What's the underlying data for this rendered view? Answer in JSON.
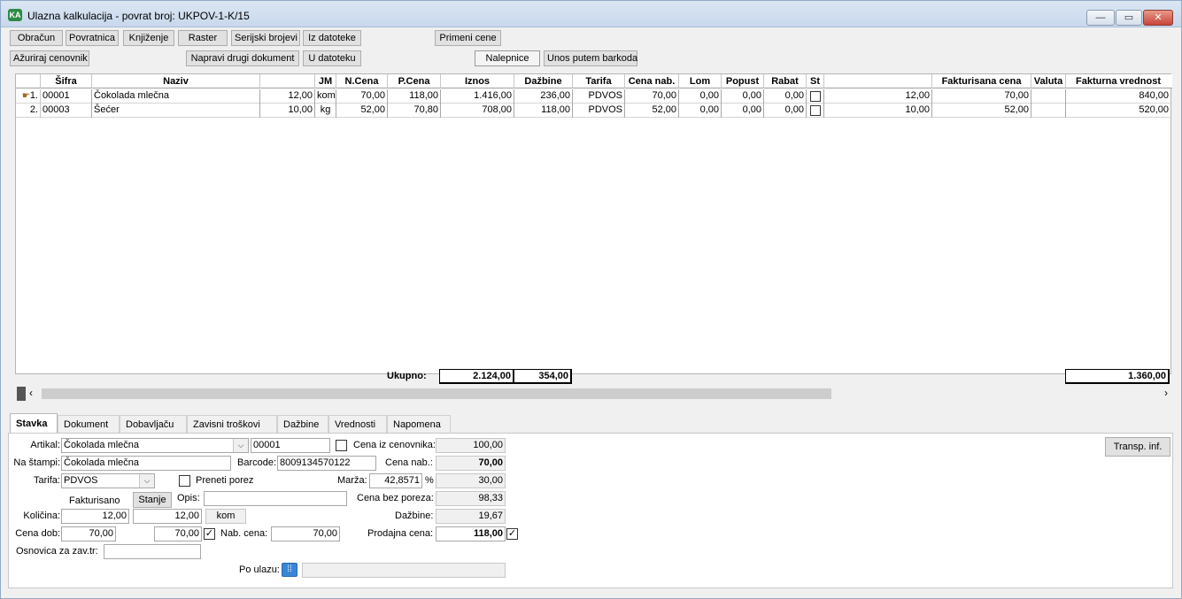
{
  "window": {
    "title": "Ulazna kalkulacija - povrat broj: UKPOV-1-K/15",
    "app_icon": "app-logo-icon"
  },
  "toolbar": {
    "obracun": "Obračun",
    "povratnica": "Povratnica",
    "knjizenje": "Knjiženje",
    "raster": "Raster",
    "serijski": "Serijski brojevi",
    "iz_datoteke": "Iz datoteke",
    "primeni_cene": "Primeni cene",
    "azuriraj": "Ažuriraj cenovnik",
    "napravi": "Napravi drugi dokument",
    "u_datoteku": "U datoteku",
    "nalepnice": "Nalepnice",
    "barkod": "Unos putem barkoda"
  },
  "grid": {
    "columns": [
      "",
      "Šifra",
      "Naziv",
      "",
      "JM",
      "N.Cena",
      "P.Cena",
      "Iznos",
      "Dažbine",
      "Tarifa",
      "Cena nab.",
      "Lom",
      "Popust",
      "Rabat",
      "St",
      "",
      "Fakturisana cena",
      "Valuta",
      "Fakturna vrednost"
    ],
    "rows": [
      {
        "num": "1.",
        "sifra": "00001",
        "naziv": "Čokolada mlečna",
        "kol": "12,00",
        "jm": "kom",
        "ncena": "70,00",
        "pcena": "118,00",
        "iznos": "1.416,00",
        "dazbine": "236,00",
        "tarifa": "PDVOS",
        "cenanab": "70,00",
        "lom": "0,00",
        "popust": "0,00",
        "rabat": "0,00",
        "kol2": "12,00",
        "fcena": "70,00",
        "valuta": "",
        "fvred": "840,00"
      },
      {
        "num": "2.",
        "sifra": "00003",
        "naziv": "Šećer",
        "kol": "10,00",
        "jm": "kg",
        "ncena": "52,00",
        "pcena": "70,80",
        "iznos": "708,00",
        "dazbine": "118,00",
        "tarifa": "PDVOS",
        "cenanab": "52,00",
        "lom": "0,00",
        "popust": "0,00",
        "rabat": "0,00",
        "kol2": "10,00",
        "fcena": "52,00",
        "valuta": "",
        "fvred": "520,00"
      }
    ],
    "totals": {
      "label": "Ukupno:",
      "iznos": "2.124,00",
      "dazbine": "354,00",
      "fvred": "1.360,00"
    }
  },
  "tabs": [
    "Stavka",
    "Dokument",
    "Dobavljaču",
    "Zavisni troškovi",
    "Dažbine",
    "Vrednosti",
    "Napomena"
  ],
  "form": {
    "artikal_label": "Artikal:",
    "artikal_value": "Čokolada mlečna",
    "artikal_code": "00001",
    "cena_iz_cenovnika_label": "Cena iz cenovnika:",
    "cena_iz_cenovnika": "100,00",
    "na_stampi_label": "Na štampi:",
    "na_stampi_value": "Čokolada mlečna",
    "barcode_label": "Barcode:",
    "barcode_value": "8009134570122",
    "cena_nab_label": "Cena nab.:",
    "cena_nab": "70,00",
    "tarifa_label": "Tarifa:",
    "tarifa_value": "PDVOS",
    "preneti_porez_label": "Preneti porez",
    "marza_label": "Marža:",
    "marza_value": "42,8571",
    "marza_unit": "%",
    "marza_amount": "30,00",
    "fakturisano_label": "Fakturisano",
    "stanje_button": "Stanje",
    "opis_label": "Opis:",
    "opis_value": "",
    "cena_bez_poreza_label": "Cena bez poreza:",
    "cena_bez_poreza": "98,33",
    "kolicina_label": "Količina:",
    "kolicina_fakt": "12,00",
    "kolicina_stanje": "12,00",
    "jm": "kom",
    "dazbine_label": "Dažbine:",
    "dazbine": "19,67",
    "cena_dob_label": "Cena dob:",
    "cena_dob_fakt": "70,00",
    "cena_dob": "70,00",
    "nab_cena_label": "Nab. cena:",
    "nab_cena": "70,00",
    "prodajna_cena_label": "Prodajna cena:",
    "prodajna_cena": "118,00",
    "osnovica_label": "Osnovica za zav.tr:",
    "osnovica_value": "",
    "po_ulazu_label": "Po ulazu:",
    "po_ulazu_value": "",
    "transp_button": "Transp. inf."
  }
}
